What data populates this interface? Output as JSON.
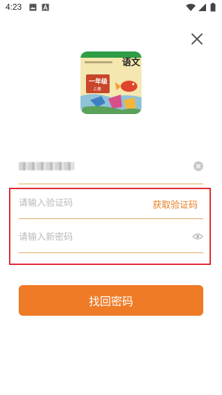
{
  "status_bar": {
    "time": "4:23",
    "left_icons": [
      "image-icon",
      "a-icon"
    ],
    "right_icons": [
      "wifi-icon",
      "signal-icon",
      "battery-icon"
    ]
  },
  "header": {
    "close_icon": "close-icon"
  },
  "logo": {
    "title": "语文",
    "grade": "一年级",
    "volume": "上册",
    "colors": {
      "background": "#f4e7b0",
      "banner": "#2e9d45",
      "grade_plate": "#c8462a"
    }
  },
  "form": {
    "phone": {
      "value": "",
      "masked": true,
      "clear_icon": "clear-circle-icon"
    },
    "code": {
      "placeholder": "请输入验证码",
      "get_code_label": "获取验证码"
    },
    "password": {
      "placeholder": "请输入新密码",
      "toggle_icon": "eye-icon"
    },
    "submit_label": "找回密码"
  },
  "colors": {
    "accent": "#f07b26",
    "link": "#e67e22",
    "highlight": "#e0282e",
    "line": "#e0a860"
  }
}
